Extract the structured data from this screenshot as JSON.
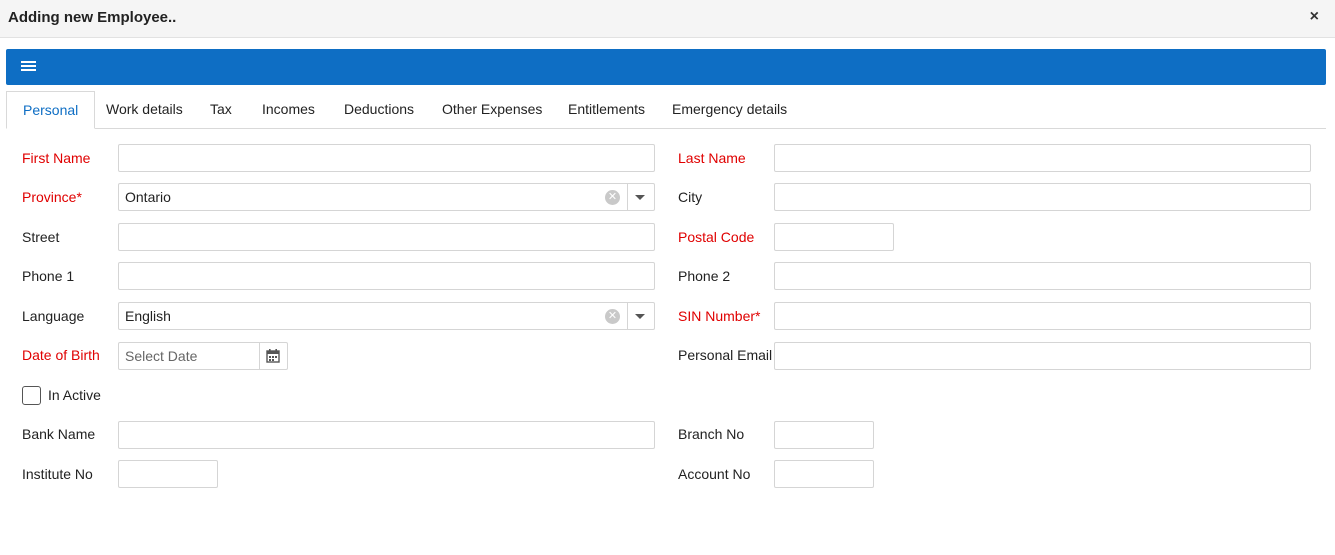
{
  "dialog": {
    "title": "Adding new Employee..",
    "close_label": "×"
  },
  "tabs": [
    {
      "label": "Personal"
    },
    {
      "label": "Work details"
    },
    {
      "label": "Tax"
    },
    {
      "label": "Incomes"
    },
    {
      "label": "Deductions"
    },
    {
      "label": "Other Expenses"
    },
    {
      "label": "Entitlements"
    },
    {
      "label": "Emergency details"
    }
  ],
  "form": {
    "first_name": {
      "label": "First Name",
      "value": ""
    },
    "last_name": {
      "label": "Last Name",
      "value": ""
    },
    "province": {
      "label": "Province*",
      "value": "Ontario"
    },
    "city": {
      "label": "City",
      "value": ""
    },
    "street": {
      "label": "Street",
      "value": ""
    },
    "postal_code": {
      "label": "Postal Code",
      "value": ""
    },
    "phone1": {
      "label": "Phone 1",
      "value": ""
    },
    "phone2": {
      "label": "Phone 2",
      "value": ""
    },
    "language": {
      "label": "Language",
      "value": "English"
    },
    "sin_number": {
      "label": "SIN Number*",
      "value": ""
    },
    "date_of_birth": {
      "label": "Date of Birth",
      "placeholder": "Select Date",
      "value": ""
    },
    "personal_email": {
      "label": "Personal Email",
      "value": ""
    },
    "in_active": {
      "label": "In Active",
      "checked": false
    },
    "bank_name": {
      "label": "Bank Name",
      "value": ""
    },
    "branch_no": {
      "label": "Branch No",
      "value": ""
    },
    "institute_no": {
      "label": "Institute No",
      "value": ""
    },
    "account_no": {
      "label": "Account No",
      "value": ""
    }
  },
  "colors": {
    "accent": "#0e6ec4",
    "required": "#e00000"
  },
  "icons": {
    "menu": "hamburger-icon",
    "close": "close-icon",
    "calendar": "calendar-icon",
    "clear": "clear-icon",
    "dropdown": "chevron-down-icon"
  }
}
